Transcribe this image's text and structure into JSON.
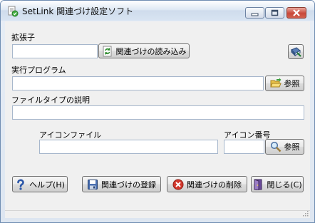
{
  "window": {
    "title": "SetLink 関連づけ設定ソフト"
  },
  "extension": {
    "label": "拡張子",
    "value": "",
    "load_button": "関連づけの読み込み"
  },
  "program": {
    "label": "実行プログラム",
    "value": "",
    "browse_button": "参照"
  },
  "description": {
    "label": "ファイルタイプの説明",
    "value": ""
  },
  "icon_file": {
    "label": "アイコンファイル",
    "value": ""
  },
  "icon_index": {
    "label": "アイコン番号",
    "value": "",
    "browse_button": "参照"
  },
  "footer": {
    "help_button": "ヘルプ(H)",
    "register_button": "関連づけの登録",
    "delete_button": "関連づけの削除",
    "close_button": "閉じる(C)"
  }
}
